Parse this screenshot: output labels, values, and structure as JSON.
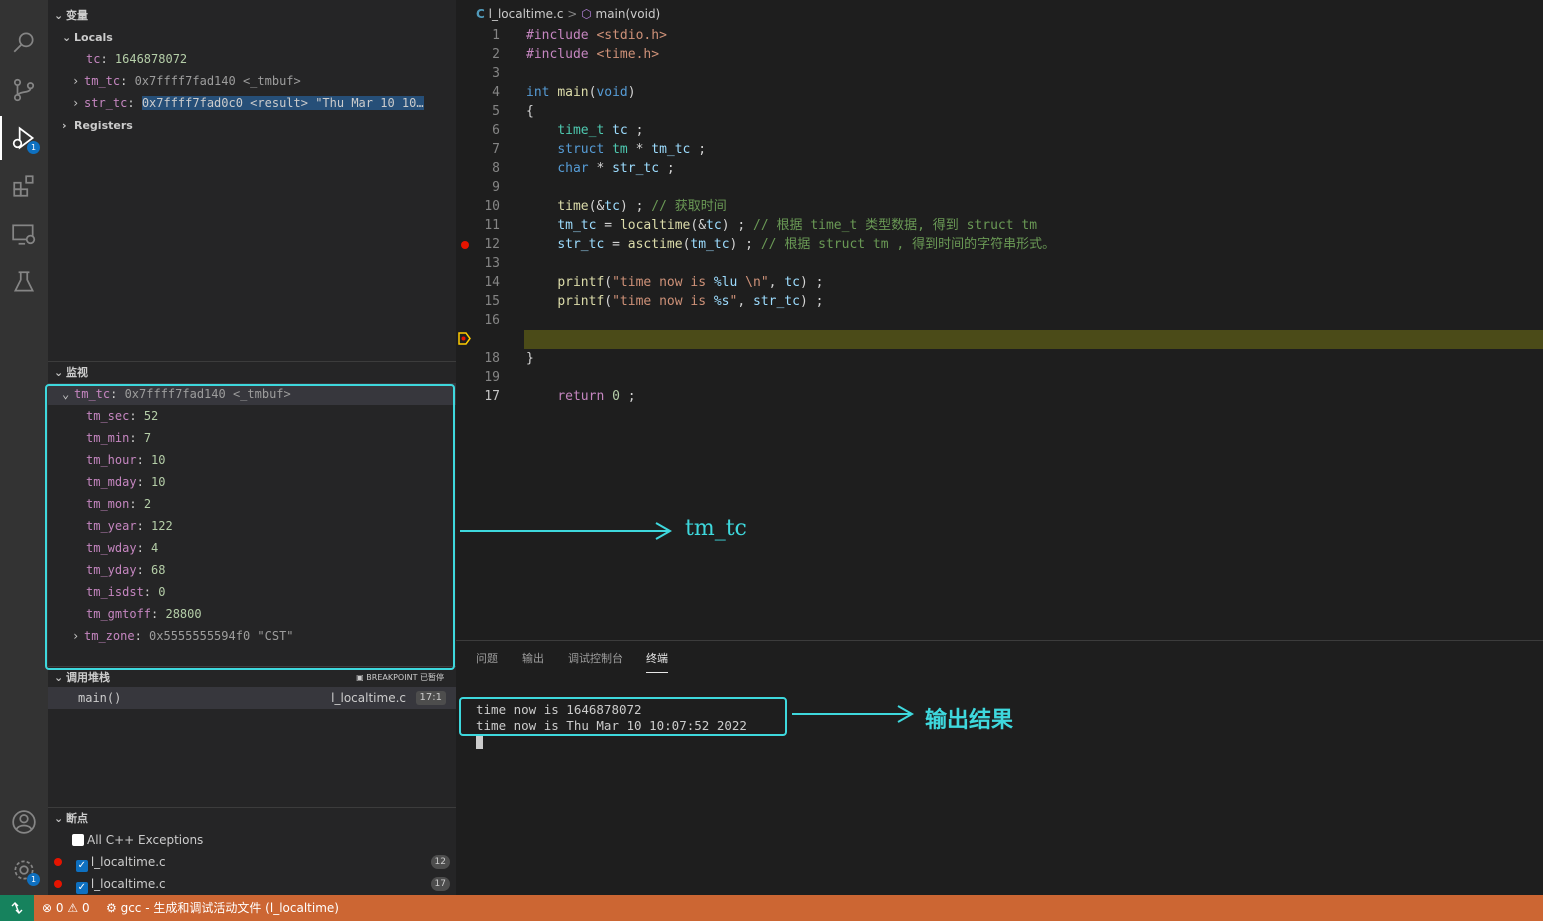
{
  "sidebar": {
    "variables": {
      "title": "变量",
      "locals_label": "Locals",
      "items": [
        {
          "name": "tc",
          "value": "1646878072"
        },
        {
          "name": "tm_tc",
          "value": "0x7ffff7fad140 <_tmbuf>"
        },
        {
          "name": "str_tc",
          "value": "0x7ffff7fad0c0 <result> \"Thu Mar 10 10…"
        }
      ],
      "registers_label": "Registers"
    },
    "watch": {
      "title": "监视",
      "root": {
        "name": "tm_tc",
        "value": "0x7ffff7fad140 <_tmbuf>"
      },
      "fields": [
        {
          "name": "tm_sec",
          "value": "52"
        },
        {
          "name": "tm_min",
          "value": "7"
        },
        {
          "name": "tm_hour",
          "value": "10"
        },
        {
          "name": "tm_mday",
          "value": "10"
        },
        {
          "name": "tm_mon",
          "value": "2"
        },
        {
          "name": "tm_year",
          "value": "122"
        },
        {
          "name": "tm_wday",
          "value": "4"
        },
        {
          "name": "tm_yday",
          "value": "68"
        },
        {
          "name": "tm_isdst",
          "value": "0"
        },
        {
          "name": "tm_gmtoff",
          "value": "28800"
        }
      ],
      "zone": {
        "name": "tm_zone",
        "value": "0x5555555594f0 \"CST\""
      }
    },
    "callstack": {
      "title": "调用堆栈",
      "status": "BREAKPOINT 已暂停",
      "frame": {
        "name": "main()",
        "file": "l_localtime.c",
        "pos": "17:1"
      }
    },
    "breakpoints": {
      "title": "断点",
      "items": [
        {
          "label": "All C++ Exceptions",
          "line": ""
        },
        {
          "label": "l_localtime.c",
          "line": "12"
        },
        {
          "label": "l_localtime.c",
          "line": "17"
        }
      ]
    }
  },
  "editor": {
    "breadcrumb": {
      "lang": "C",
      "file": "l_localtime.c",
      "sep": ">",
      "symbol": "main(void)"
    },
    "current_line": 17,
    "breakpoint_line": 12
  },
  "panel": {
    "tabs": [
      "问题",
      "输出",
      "调试控制台",
      "终端"
    ],
    "active_tab": "终端",
    "terminal_lines": [
      "time now is 1646878072",
      "time now is Thu Mar 10 10:07:52 2022"
    ]
  },
  "status": {
    "errors": "0",
    "warnings": "0",
    "task": "gcc - 生成和调试活动文件 (l_localtime)"
  },
  "annotations": {
    "watch_label": "tm_tc",
    "output_label": "输出结果"
  },
  "colors": {
    "status_bar": "#cc6633",
    "annotation": "#3ed8dd",
    "current_line_highlight": "#4b4b18"
  }
}
